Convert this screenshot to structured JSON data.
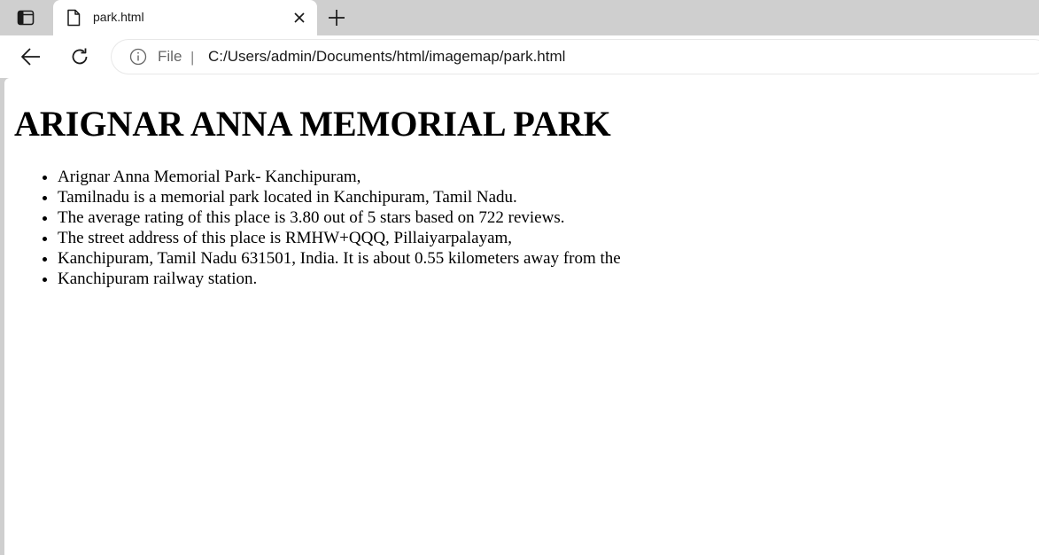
{
  "browser": {
    "tab": {
      "title": "park.html"
    },
    "address_bar": {
      "scheme_label": "File",
      "divider": "|",
      "url": "C:/Users/admin/Documents/html/imagemap/park.html"
    },
    "icons": {
      "tab_actions": "tab-actions-icon",
      "page": "page-icon",
      "close": "close-icon",
      "new_tab": "plus-icon",
      "back": "back-arrow-icon",
      "reload": "reload-icon",
      "info": "info-icon"
    }
  },
  "page": {
    "heading": "ARIGNAR ANNA MEMORIAL PARK",
    "list_items": [
      "Arignar Anna Memorial Park- Kanchipuram,",
      "Tamilnadu is a memorial park located in Kanchipuram, Tamil Nadu.",
      "The average rating of this place is 3.80 out of 5 stars based on 722 reviews.",
      "The street address of this place is RMHW+QQQ, Pillaiyarpalayam,",
      "Kanchipuram, Tamil Nadu 631501, India. It is about 0.55 kilometers away from the",
      "Kanchipuram railway station."
    ]
  }
}
